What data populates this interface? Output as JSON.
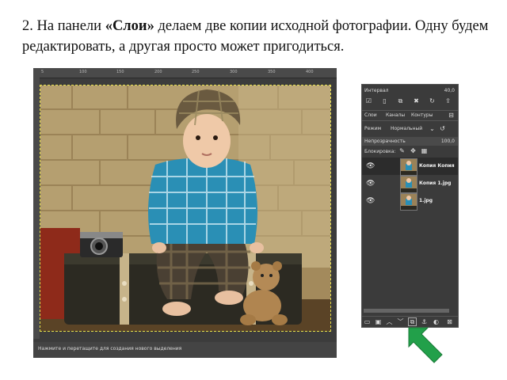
{
  "instruction": {
    "step": "2. На панели ",
    "panel_name": "«Слои»",
    "rest": " делаем две копии исходной фотографии. Одну будем редактировать, а другая просто может пригодиться."
  },
  "canvas": {
    "ruler_ticks": [
      "5",
      "100",
      "150",
      "200",
      "250",
      "300",
      "350",
      "400"
    ],
    "status_text": "Нажмите и перетащите для создания нового выделения"
  },
  "layers_panel": {
    "interval_label": "Интервал",
    "interval_value": "40,0",
    "tabs": [
      "Слои",
      "Каналы",
      "Контуры"
    ],
    "mode_label": "Режим",
    "mode_value": "Нормальный",
    "opacity_label": "Непрозрачность",
    "opacity_value": "100,0",
    "lock_label": "Блокировка:",
    "layers": [
      {
        "name": "Копия Копия",
        "visible": true,
        "selected": true
      },
      {
        "name": "Копия 1.jpg",
        "visible": true,
        "selected": false
      },
      {
        "name": "1.jpg",
        "visible": true,
        "selected": false
      }
    ]
  },
  "colors": {
    "arrow": "#22a04a",
    "panel_bg": "#3b3b3b",
    "selection": "#e6e04a"
  }
}
